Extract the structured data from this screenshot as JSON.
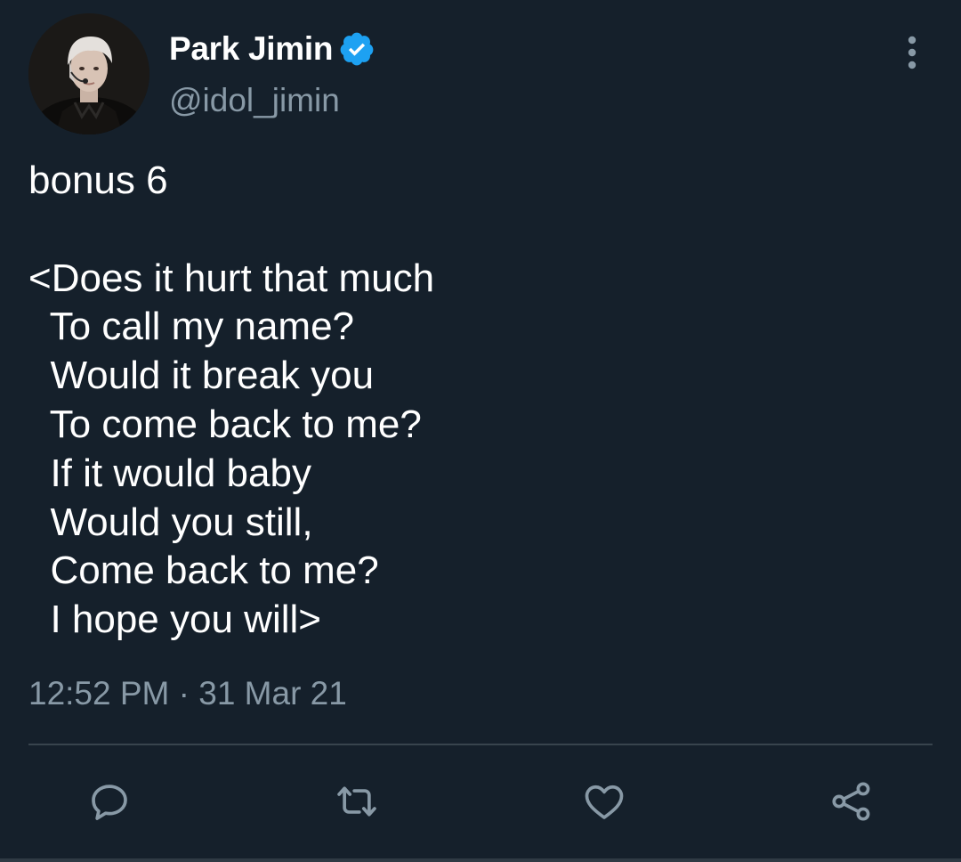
{
  "tweet": {
    "author": {
      "display_name": "Park Jimin",
      "handle": "@idol_jimin",
      "verified": true,
      "avatar_icon": "profile-photo",
      "verified_icon": "verified-badge-icon"
    },
    "text": "bonus 6\n\n<Does it hurt that much\n  To call my name?\n  Would it break you\n  To come back to me?\n  If it would baby\n  Would you still,\n  Come back to me?\n  I hope you will>",
    "timestamp": "12:52 PM · 31 Mar 21",
    "actions": {
      "reply_icon": "comment-icon",
      "retweet_icon": "retweet-icon",
      "like_icon": "heart-icon",
      "share_icon": "share-icon"
    },
    "more_icon": "vertical-ellipsis-icon"
  },
  "colors": {
    "background": "#15202b",
    "primary_text": "#ffffff",
    "secondary_text": "#8899a6",
    "icon": "#8899a6",
    "verified": "#1da1f2",
    "divider": "#38444d"
  }
}
